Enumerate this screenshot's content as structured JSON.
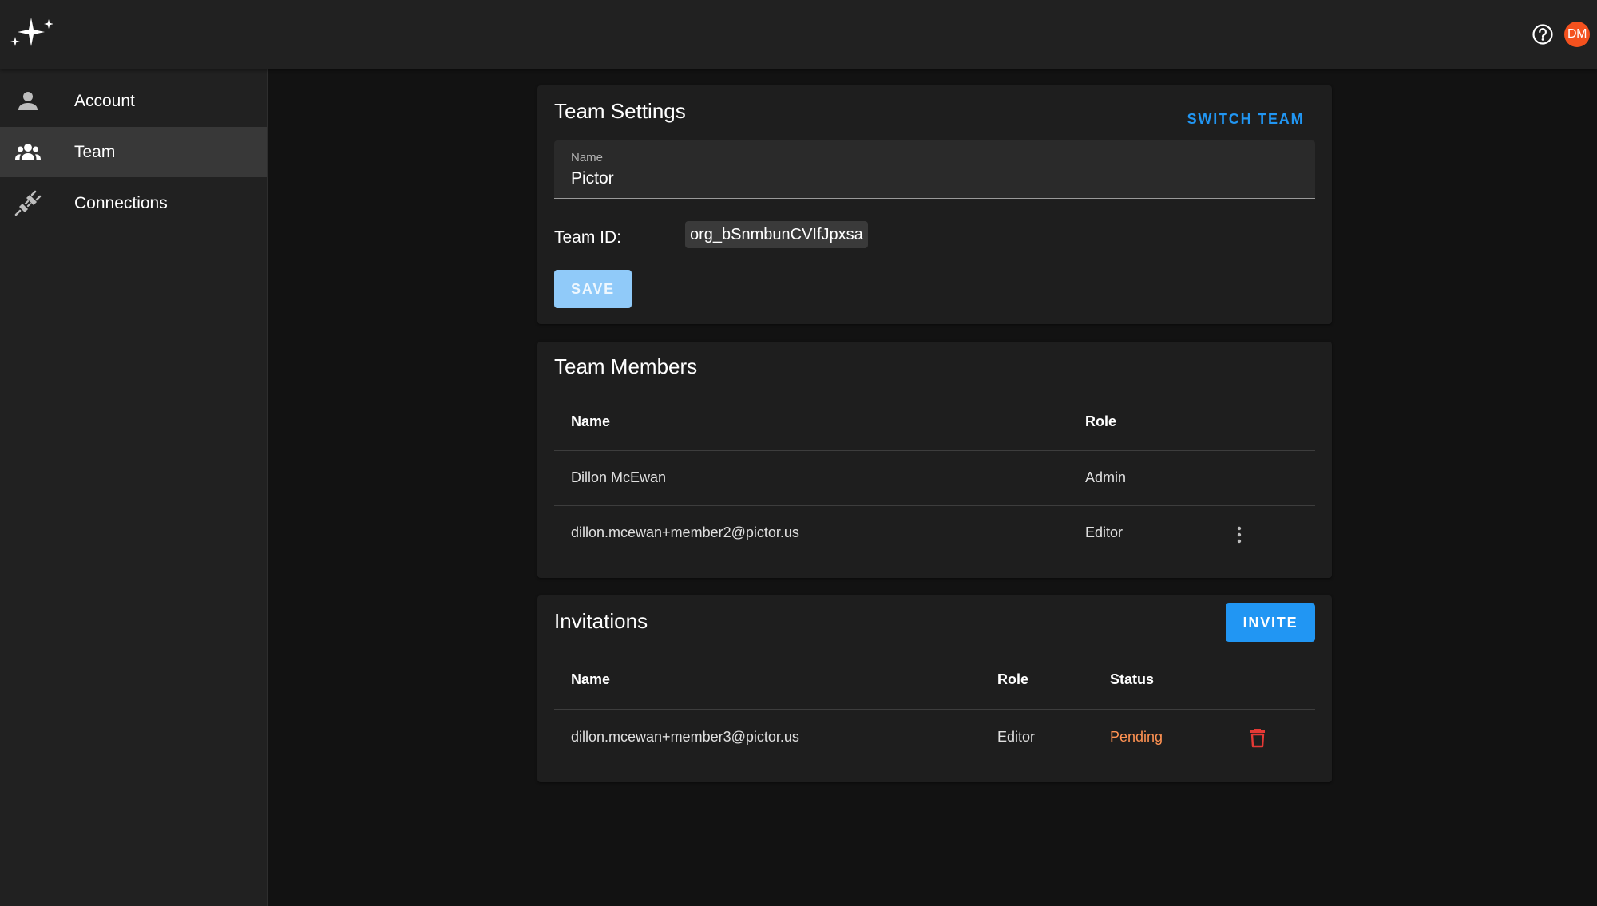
{
  "colors": {
    "accent": "#2196f3",
    "save_disabled": "#90caf9",
    "avatar": "#f4511e",
    "pending": "#ff9252",
    "delete": "#e53935"
  },
  "header": {
    "logo_icon": "sparkle-logo",
    "help_icon": "help-circle-icon",
    "avatar_initials": "DM"
  },
  "sidebar": {
    "items": [
      {
        "label": "Account",
        "icon": "person-icon",
        "active": false
      },
      {
        "label": "Team",
        "icon": "group-icon",
        "active": true
      },
      {
        "label": "Connections",
        "icon": "plug-icon",
        "active": false
      }
    ]
  },
  "team_settings": {
    "title": "Team Settings",
    "switch_team_label": "SWITCH TEAM",
    "name_field_label": "Name",
    "name_value": "Pictor",
    "team_id_label": "Team ID:",
    "team_id_value": "org_bSnmbunCVIfJpxsa",
    "save_label": "SAVE"
  },
  "team_members": {
    "title": "Team Members",
    "columns": [
      "Name",
      "Role"
    ],
    "rows": [
      {
        "name": "Dillon McEwan",
        "role": "Admin",
        "menu": false
      },
      {
        "name": "dillon.mcewan+member2@pictor.us",
        "role": "Editor",
        "menu": true
      }
    ]
  },
  "invitations": {
    "title": "Invitations",
    "invite_label": "INVITE",
    "columns": [
      "Name",
      "Role",
      "Status"
    ],
    "rows": [
      {
        "name": "dillon.mcewan+member3@pictor.us",
        "role": "Editor",
        "status": "Pending"
      }
    ]
  }
}
